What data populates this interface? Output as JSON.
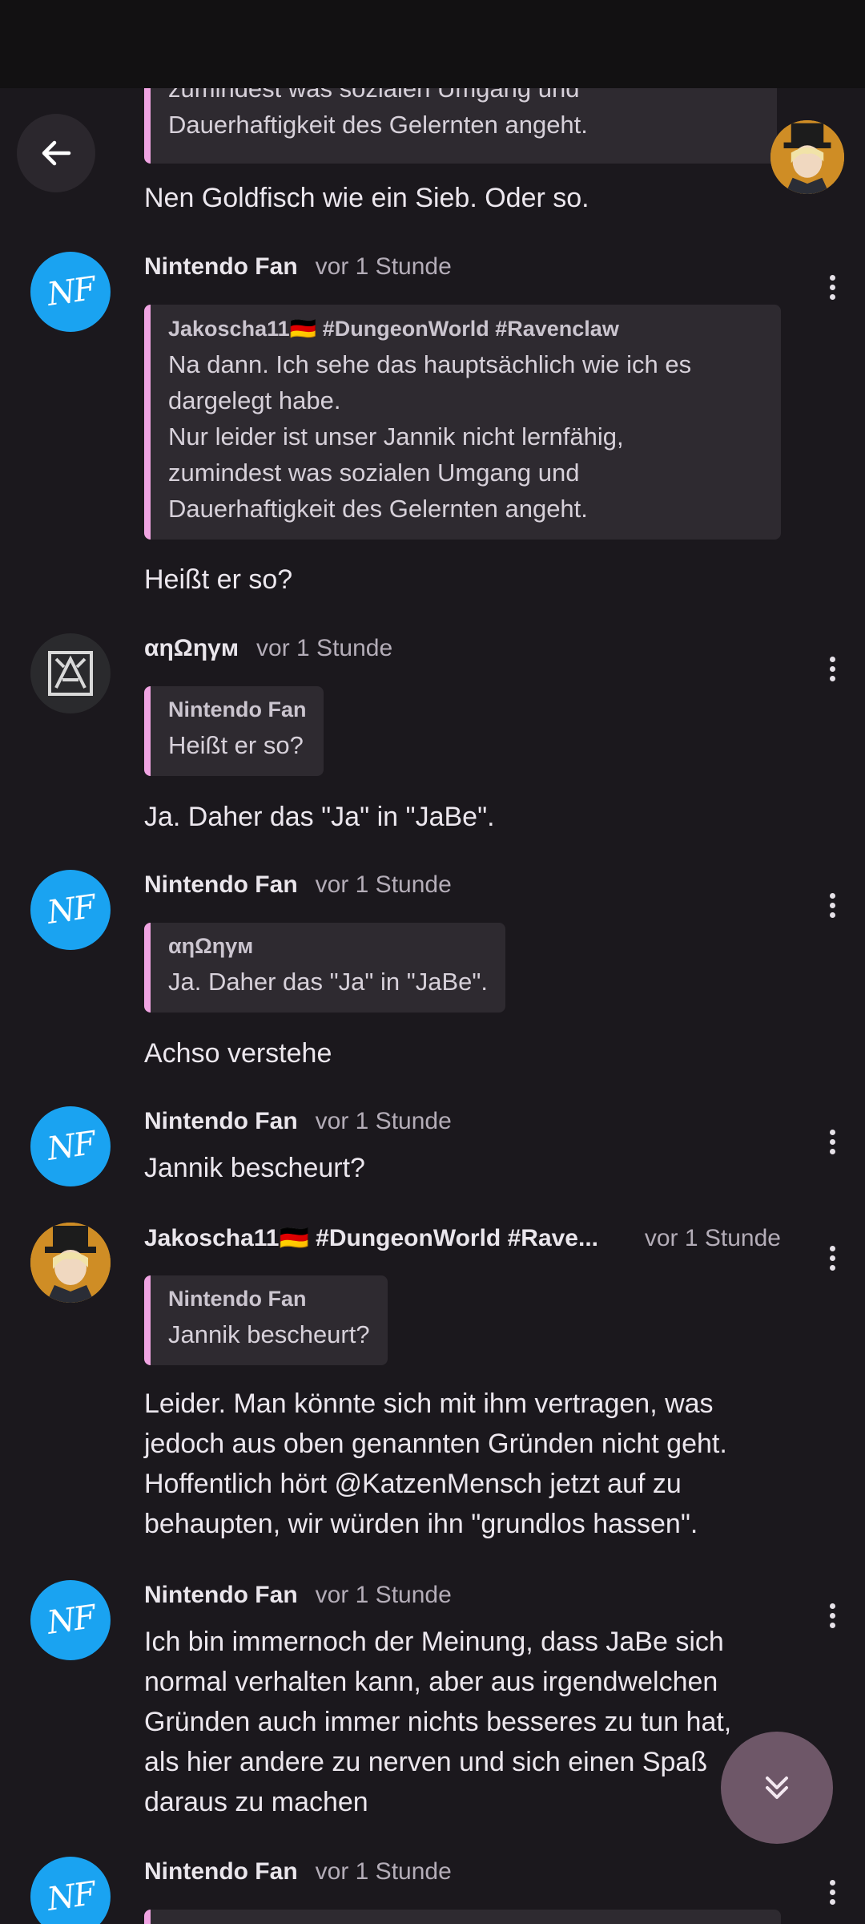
{
  "top_partial": {
    "quote_line1": "zumindest was sozialen Umgang und",
    "quote_line2": "Dauerhaftigkeit des Gelernten angeht.",
    "body": "Nen Goldfisch wie ein Sieb. Oder so."
  },
  "messages": [
    {
      "author": "Nintendo Fan",
      "avatar_initials": "NF",
      "time": "vor 1 Stunde",
      "quote": {
        "author": "Jakoscha11🇩🇪 #DungeonWorld #Ravenclaw",
        "lines": [
          "Na dann. Ich sehe das hauptsächlich wie ich es",
          "dargelegt habe.",
          "Nur leider ist unser Jannik nicht lernfähig,",
          "zumindest was sozialen Umgang und",
          "Dauerhaftigkeit des Gelernten angeht."
        ]
      },
      "body": "Heißt er so?"
    },
    {
      "author": "αηΩηγм",
      "time": "vor 1 Stunde",
      "quote": {
        "author": "Nintendo Fan",
        "lines": [
          "Heißt er so?"
        ]
      },
      "body": "Ja. Daher das \"Ja\" in \"JaBe\"."
    },
    {
      "author": "Nintendo Fan",
      "avatar_initials": "NF",
      "time": "vor 1 Stunde",
      "quote": {
        "author": "αηΩηγм",
        "lines": [
          "Ja. Daher das \"Ja\" in \"JaBe\"."
        ]
      },
      "body": "Achso verstehe"
    },
    {
      "author": "Nintendo Fan",
      "avatar_initials": "NF",
      "time": "vor 1 Stunde",
      "body": "Jannik bescheurt?"
    },
    {
      "author": "Jakoscha11🇩🇪 #DungeonWorld #Rave...",
      "time": "vor 1 Stunde",
      "quote": {
        "author": "Nintendo Fan",
        "lines": [
          "Jannik bescheurt?"
        ]
      },
      "body_lines": [
        "Leider. Man könnte sich mit ihm vertragen, was",
        "jedoch aus oben genannten Gründen nicht geht.",
        "Hoffentlich hört @KatzenMensch jetzt auf zu",
        "behaupten, wir würden ihn \"grundlos hassen\"."
      ]
    },
    {
      "author": "Nintendo Fan",
      "avatar_initials": "NF",
      "time": "vor 1 Stunde",
      "body_lines": [
        "Ich bin immernoch der Meinung, dass JaBe sich",
        "normal verhalten kann, aber aus irgendwelchen",
        "Gründen auch immer nichts besseres zu tun hat,",
        "als hier andere zu nerven und sich einen Spaß",
        "daraus zu machen"
      ]
    },
    {
      "author": "Nintendo Fan",
      "avatar_initials": "NF",
      "time": "vor 1 Stunde"
    }
  ],
  "colors": {
    "background": "#1b181d",
    "quote_bar": "#f0a4e2",
    "nf_avatar": "#1aa3f1",
    "fab": "#6e5768"
  },
  "icons": {
    "back": "arrow-left-icon",
    "more": "more-vertical-icon",
    "scroll_down": "double-chevron-down-icon"
  }
}
